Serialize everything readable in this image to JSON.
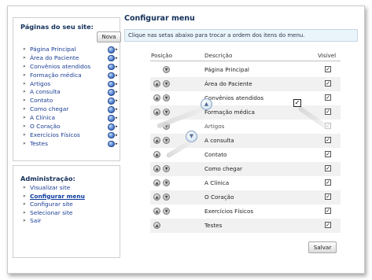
{
  "sidebar": {
    "pages_title": "Páginas do seu site:",
    "new_button": "Nova",
    "pages": [
      {
        "label": "Página Principal"
      },
      {
        "label": "Área do Paciente"
      },
      {
        "label": "Convênios atendidos"
      },
      {
        "label": "Formação médica"
      },
      {
        "label": "Artigos"
      },
      {
        "label": "A consulta"
      },
      {
        "label": "Contato"
      },
      {
        "label": "Como chegar"
      },
      {
        "label": "A Clínica"
      },
      {
        "label": "O Coração"
      },
      {
        "label": "Exercícios Físicos"
      },
      {
        "label": "Testes"
      }
    ],
    "admin_title": "Administração:",
    "admin_items": [
      {
        "label": "Visualizar site"
      },
      {
        "label": "Configurar menu"
      },
      {
        "label": "Configurar site"
      },
      {
        "label": "Selecionar site"
      },
      {
        "label": "Sair"
      }
    ]
  },
  "main": {
    "title": "Configurar menu",
    "info": "Clique nas setas abaixo para trocar a ordem dos itens do menu.",
    "columns": {
      "position": "Posição",
      "description": "Descrição",
      "visible": "Visível"
    },
    "rows": [
      {
        "description": "Página Principal",
        "visible": true
      },
      {
        "description": "Área do Paciente",
        "visible": true
      },
      {
        "description": "Convênios atendidos",
        "visible": true
      },
      {
        "description": "Formação médica",
        "visible": true
      },
      {
        "description": "Artigos",
        "visible": true
      },
      {
        "description": "A consulta",
        "visible": true
      },
      {
        "description": "Contato",
        "visible": true
      },
      {
        "description": "Como chegar",
        "visible": true
      },
      {
        "description": "A Clínica",
        "visible": true
      },
      {
        "description": "O Coração",
        "visible": true
      },
      {
        "description": "Exercícios Físicos",
        "visible": true
      },
      {
        "description": "Testes",
        "visible": true
      }
    ],
    "save_button": "Salvar"
  },
  "icons": {
    "bullet": "»",
    "globe": "globe-icon",
    "menu_arrow": "▸",
    "move_up": "▲",
    "move_down": "▼",
    "check": "✓"
  },
  "colors": {
    "heading": "#14305a",
    "link": "#1b3e94",
    "info_bg": "#eaf4fb"
  }
}
